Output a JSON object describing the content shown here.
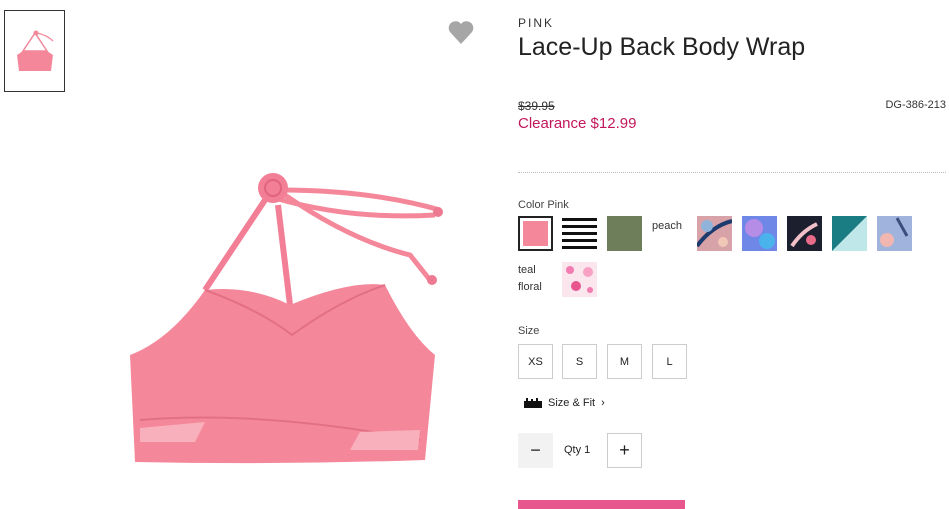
{
  "thumbnail": {
    "alt": "product thumbnail"
  },
  "product": {
    "brand": "PINK",
    "title": "Lace-Up Back Body Wrap",
    "original_price": "$39.95",
    "sale_price": "Clearance $12.99",
    "sku": "DG-386-213"
  },
  "color": {
    "label": "Color Pink",
    "selected": "Pink",
    "swatches": [
      {
        "name": "pink",
        "color": "#f4889a"
      },
      {
        "name": "black stripe",
        "color": "#111111"
      },
      {
        "name": "olive",
        "color": "#6f7e5a"
      },
      {
        "name": "peach",
        "text": "peach"
      },
      {
        "name": "tropical pink",
        "color": "#d8a3a8"
      },
      {
        "name": "blue tie-dye",
        "color": "#6f88e8"
      },
      {
        "name": "black floral",
        "color": "#1c1f2e"
      },
      {
        "name": "teal",
        "color": "#1a7d84"
      },
      {
        "name": "pastel floral",
        "color": "#9fb3dc"
      },
      {
        "name": "teal floral",
        "text": "teal floral"
      },
      {
        "name": "pink floral",
        "color": "#f27bb0"
      }
    ]
  },
  "size": {
    "label": "Size",
    "options": [
      "XS",
      "S",
      "M",
      "L"
    ],
    "size_fit": "Size & Fit"
  },
  "quantity": {
    "label": "Qty 1",
    "minus": "−",
    "plus": "+"
  },
  "accent_color": "#c2185b",
  "button_color": "#e8568e"
}
